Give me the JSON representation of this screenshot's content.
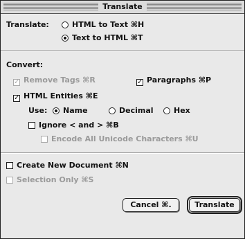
{
  "window": {
    "title": "Translate"
  },
  "translate": {
    "label": "Translate:",
    "options": [
      {
        "label": "HTML to Text ⌘H",
        "selected": false
      },
      {
        "label": "Text to HTML ⌘T",
        "selected": true
      }
    ]
  },
  "convert": {
    "label": "Convert:",
    "remove_tags": {
      "label": "Remove Tags ⌘R",
      "checked": true,
      "enabled": false
    },
    "paragraphs": {
      "label": "Paragraphs ⌘P",
      "checked": true,
      "enabled": true
    },
    "html_entities": {
      "label": "HTML Entities ⌘E",
      "checked": true,
      "enabled": true
    },
    "use": {
      "label": "Use:",
      "options": [
        {
          "label": "Name",
          "selected": true
        },
        {
          "label": "Decimal",
          "selected": false
        },
        {
          "label": "Hex",
          "selected": false
        }
      ]
    },
    "ignore": {
      "label": "Ignore < and > ⌘B",
      "checked": false,
      "enabled": true
    },
    "encode_unicode": {
      "label": "Encode All Unicode Characters ⌘U",
      "checked": false,
      "enabled": false
    }
  },
  "create_new_document": {
    "label": "Create New Document ⌘N",
    "checked": false,
    "enabled": true
  },
  "selection_only": {
    "label": "Selection Only ⌘S",
    "checked": false,
    "enabled": false
  },
  "buttons": {
    "cancel": "Cancel ⌘.",
    "translate": "Translate"
  }
}
